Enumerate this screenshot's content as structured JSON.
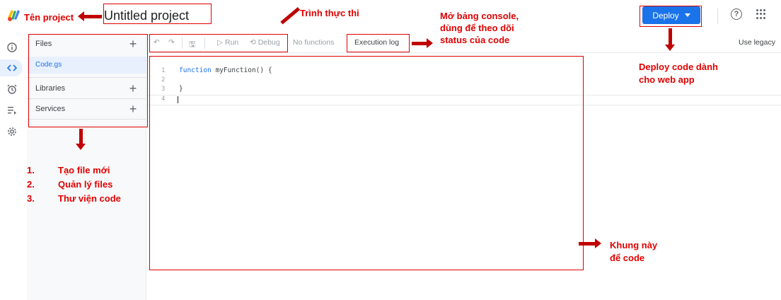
{
  "header": {
    "project_name": "Untitled project",
    "deploy_label": "Deploy",
    "help_icon": "help-circle-icon",
    "apps_icon": "apps-grid-icon"
  },
  "rail": {
    "icons": [
      "info-icon",
      "code-icon",
      "alarm-clock-icon",
      "executions-icon",
      "settings-gear-icon"
    ]
  },
  "files_panel": {
    "files_label": "Files",
    "file_name": "Code.gs",
    "libraries_label": "Libraries",
    "services_label": "Services"
  },
  "toolbar": {
    "run_label": "Run",
    "debug_label": "Debug",
    "function_select": "No functions",
    "execution_log_label": "Execution log",
    "use_legacy_label": "Use legacy"
  },
  "editor": {
    "lines": [
      "1",
      "2",
      "3",
      "4"
    ],
    "code_line1_kw": "function",
    "code_line1_rest": " myFunction() {",
    "code_line3": "}"
  },
  "annotations": {
    "project_name_note": "Tên project",
    "runner_note": "Trình thực thi",
    "console_note_1": "Mở bảng console,",
    "console_note_2": "dùng để theo dõi",
    "console_note_3": "status của code",
    "deploy_note_1": "Deploy code dành",
    "deploy_note_2": "cho web app",
    "list_num_1": "1.",
    "list_num_2": "2.",
    "list_num_3": "3.",
    "list_1": "Tạo file mới",
    "list_2": "Quản lý files",
    "list_3": "Thư viện code",
    "editor_note_1": "Khung này",
    "editor_note_2": "để code"
  },
  "colors": {
    "accent": "#1a73e8",
    "annotation": "#e00000"
  }
}
